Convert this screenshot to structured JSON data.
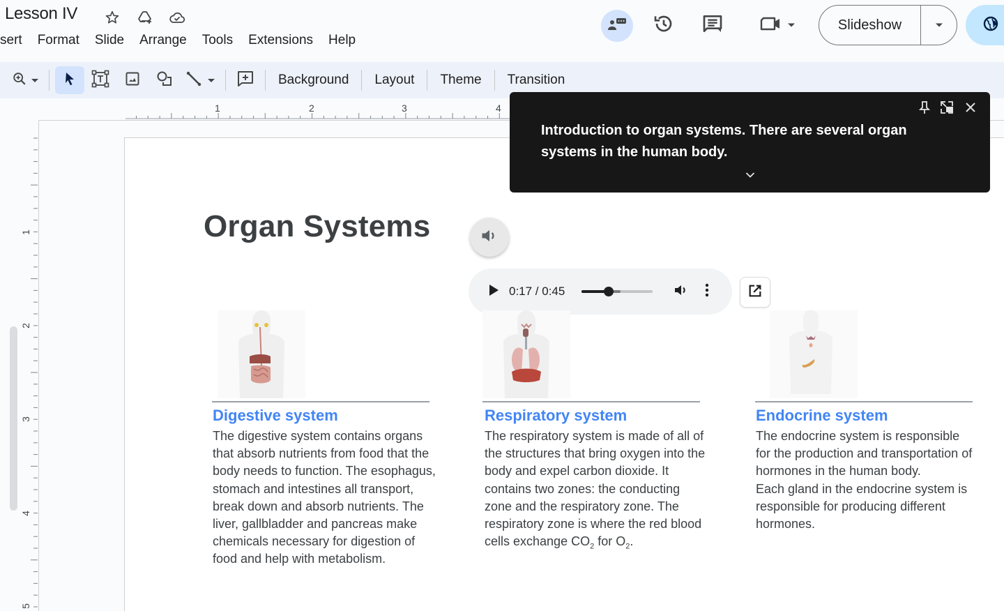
{
  "header": {
    "doc_title": "Lesson IV",
    "title_icons": [
      "star-icon",
      "move-to-drive-icon",
      "cloud-saved-icon"
    ],
    "menu": [
      "sert",
      "Format",
      "Slide",
      "Arrange",
      "Tools",
      "Extensions",
      "Help"
    ],
    "slideshow_label": "Slideshow",
    "right_icons": [
      "present-to-call-icon",
      "version-history-icon",
      "comments-icon",
      "meet-icon",
      "share-globe-icon"
    ]
  },
  "toolbar": {
    "icons": [
      "zoom-icon",
      "select-icon",
      "text-box-icon",
      "image-icon",
      "shape-icon",
      "line-icon",
      "comment-add-icon"
    ],
    "buttons": [
      "Background",
      "Layout",
      "Theme",
      "Transition"
    ]
  },
  "rulers": {
    "horizontal_labels": [
      "1",
      "2",
      "3",
      "4"
    ],
    "vertical_labels": [
      "1",
      "2",
      "3",
      "4",
      "5"
    ]
  },
  "caption": {
    "text": "Introduction to organ systems. There are several organ systems in the human body.",
    "icons": [
      "pin-icon",
      "picture-in-picture-icon",
      "close-icon",
      "expand-chevron-icon"
    ]
  },
  "slide": {
    "title": "Organ Systems",
    "audio": {
      "current": "0:17",
      "duration": "0:45",
      "time_label": "0:17 / 0:45",
      "progress_fraction": 0.378,
      "buffered_fraction": 0.55
    },
    "colors": {
      "heading": "#4285f4",
      "body": "#3c4043"
    },
    "organs": [
      {
        "heading": "Digestive system",
        "body": "The digestive system contains organs that absorb nutrients from food that the body needs to function. The esophagus, stomach and intestines all transport, break down and absorb nutrients. The liver, gallbladder and pancreas make chemicals necessary for digestion of food and help with metabolism."
      },
      {
        "heading": "Respiratory system",
        "body_parts": [
          "The respiratory system is made of all of the structures that bring oxygen into the body and expel carbon dioxide. It contains two zones: the conducting zone and the respiratory zone. The respiratory zone is where the red blood cells exchange CO",
          "2",
          " for O",
          "2",
          "."
        ]
      },
      {
        "heading": "Endocrine system",
        "body_line1": "The endocrine system is responsible for the production and transportation of hormones in the human body.",
        "body_line2": "Each gland in the endocrine system is responsible for producing different hormones."
      }
    ]
  }
}
